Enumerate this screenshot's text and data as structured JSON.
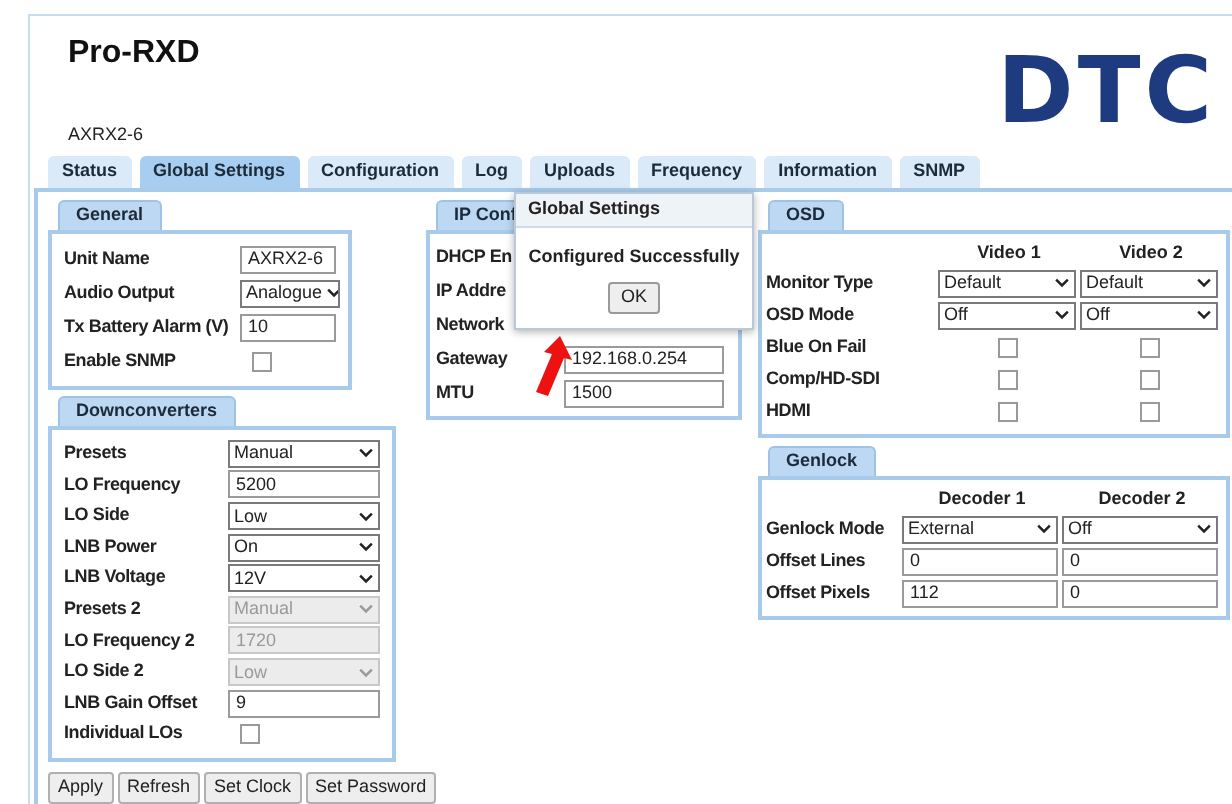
{
  "header": {
    "title": "Pro-RXD",
    "logo": "DTC",
    "unit": "AXRX2-6"
  },
  "tabs": [
    {
      "label": "Status",
      "selected": false
    },
    {
      "label": "Global Settings",
      "selected": true
    },
    {
      "label": "Configuration",
      "selected": false
    },
    {
      "label": "Log",
      "selected": false
    },
    {
      "label": "Uploads",
      "selected": false
    },
    {
      "label": "Frequency",
      "selected": false
    },
    {
      "label": "Information",
      "selected": false
    },
    {
      "label": "SNMP",
      "selected": false
    }
  ],
  "general": {
    "title": "General",
    "rows": [
      {
        "label": "Unit Name",
        "kind": "text",
        "value": "AXRX2-6"
      },
      {
        "label": "Audio Output",
        "kind": "select",
        "value": "Analogue"
      },
      {
        "label": "Tx Battery Alarm (V)",
        "kind": "text",
        "value": "10"
      },
      {
        "label": "Enable SNMP",
        "kind": "checkbox",
        "checked": false
      }
    ]
  },
  "downconverters": {
    "title": "Downconverters",
    "rows": [
      {
        "label": "Presets",
        "kind": "select",
        "value": "Manual",
        "disabled": false
      },
      {
        "label": "LO Frequency",
        "kind": "text",
        "value": "5200",
        "disabled": false
      },
      {
        "label": "LO Side",
        "kind": "select",
        "value": "Low",
        "disabled": false
      },
      {
        "label": "LNB Power",
        "kind": "select",
        "value": "On",
        "disabled": false
      },
      {
        "label": "LNB Voltage",
        "kind": "select",
        "value": "12V",
        "disabled": false
      },
      {
        "label": "Presets 2",
        "kind": "select",
        "value": "Manual",
        "disabled": true
      },
      {
        "label": "LO Frequency 2",
        "kind": "text",
        "value": "1720",
        "disabled": true
      },
      {
        "label": "LO Side 2",
        "kind": "select",
        "value": "Low",
        "disabled": true
      },
      {
        "label": "LNB Gain Offset",
        "kind": "text",
        "value": "9",
        "disabled": false
      },
      {
        "label": "Individual LOs",
        "kind": "checkbox",
        "checked": false,
        "disabled": false
      }
    ]
  },
  "ip_config": {
    "title": "IP Conf",
    "rows": [
      {
        "label": "DHCP En"
      },
      {
        "label": "IP Addre"
      },
      {
        "label": "Network"
      },
      {
        "label": "Gateway",
        "value": "192.168.0.254"
      },
      {
        "label": "MTU",
        "value": "1500"
      }
    ]
  },
  "osd": {
    "title": "OSD",
    "columns": [
      "Video 1",
      "Video 2"
    ],
    "rows": [
      {
        "label": "Monitor Type",
        "kind": "select",
        "values": [
          "Default",
          "Default"
        ]
      },
      {
        "label": "OSD Mode",
        "kind": "select",
        "values": [
          "Off",
          "Off"
        ]
      },
      {
        "label": "Blue On Fail",
        "kind": "checkbox",
        "checked": [
          false,
          false
        ]
      },
      {
        "label": "Comp/HD-SDI",
        "kind": "checkbox",
        "checked": [
          false,
          false
        ]
      },
      {
        "label": "HDMI",
        "kind": "checkbox",
        "checked": [
          false,
          false
        ]
      }
    ]
  },
  "genlock": {
    "title": "Genlock",
    "columns": [
      "Decoder 1",
      "Decoder 2"
    ],
    "rows": [
      {
        "label": "Genlock Mode",
        "kind": "select",
        "values": [
          "External",
          "Off"
        ]
      },
      {
        "label": "Offset Lines",
        "kind": "text",
        "values": [
          "0",
          "0"
        ]
      },
      {
        "label": "Offset Pixels",
        "kind": "text",
        "values": [
          "112",
          "0"
        ]
      }
    ]
  },
  "buttons": [
    "Apply",
    "Refresh",
    "Set Clock",
    "Set Password"
  ],
  "dialog": {
    "title": "Global Settings",
    "message": "Configured Successfully",
    "button": "OK"
  }
}
